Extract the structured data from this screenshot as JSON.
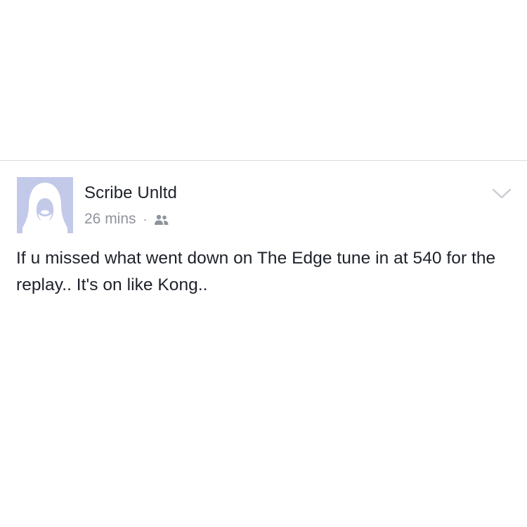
{
  "post": {
    "author": "Scribe Unltd",
    "timestamp": "26 mins",
    "separator": "·",
    "audience_icon": "friends-icon",
    "menu_icon": "chevron-down-icon",
    "avatar_icon": "default-profile-silhouette",
    "message": "If u missed what went down on The Edge tune in at 540 for the replay.. It's on like Kong.."
  },
  "colors": {
    "background": "#ffffff",
    "divider": "#d9dadd",
    "primary_text": "#1d2129",
    "secondary_text": "#90949c",
    "avatar_background": "#c3c9e9"
  }
}
